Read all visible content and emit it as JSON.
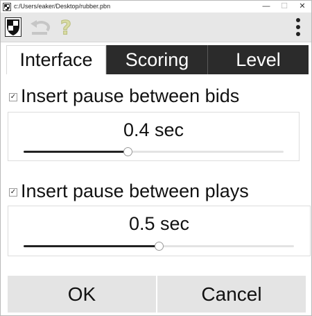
{
  "window": {
    "title": "c:/Users/eaker/Desktop/rubber.pbn",
    "accent_color": "#2b2b2b"
  },
  "window_controls": {
    "minimize": "—",
    "maximize": "☐",
    "close": "✕"
  },
  "toolbar": {
    "icons": [
      "shield-icon",
      "undo-icon",
      "help-icon",
      "more-vert-icon"
    ],
    "help_glyph": "?"
  },
  "tabs": [
    {
      "label": "Interface",
      "active": true
    },
    {
      "label": "Scoring",
      "active": false
    },
    {
      "label": "Level",
      "active": false
    }
  ],
  "options": {
    "bids": {
      "checked": true,
      "check_glyph": "✓",
      "label": "Insert pause between bids",
      "value_text": "0.4 sec",
      "slider_fraction": 0.4
    },
    "plays": {
      "checked": true,
      "check_glyph": "✓",
      "label": "Insert pause between plays",
      "value_text": "0.5 sec",
      "slider_fraction": 0.5
    }
  },
  "buttons": {
    "ok_label": "OK",
    "cancel_label": "Cancel"
  }
}
